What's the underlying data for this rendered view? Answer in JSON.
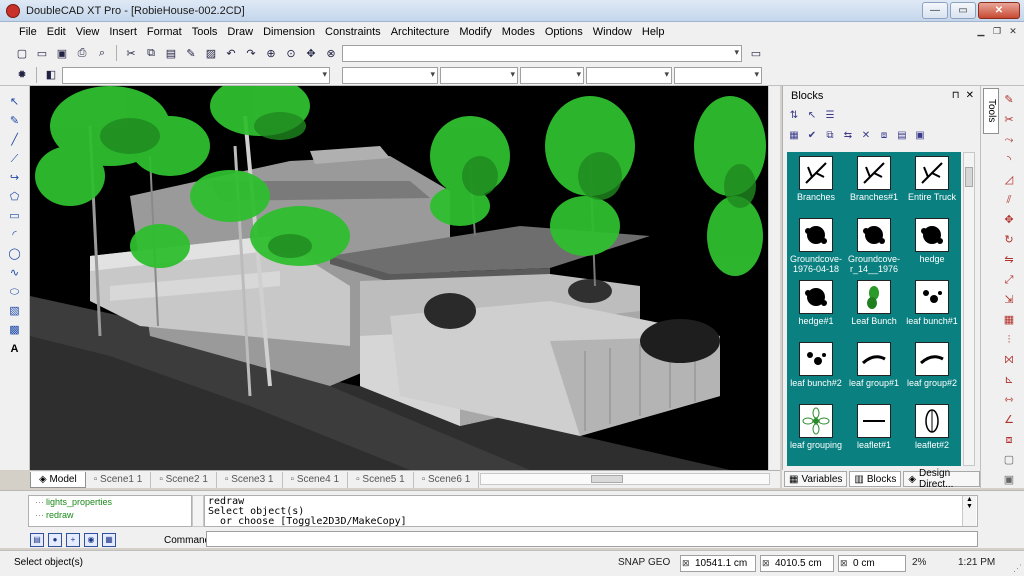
{
  "window": {
    "title": "DoubleCAD XT Pro - [RobieHouse-002.2CD]",
    "buttons": [
      "—",
      "▭",
      "✕"
    ]
  },
  "menu": [
    "File",
    "Edit",
    "View",
    "Insert",
    "Format",
    "Tools",
    "Draw",
    "Dimension",
    "Constraints",
    "Architecture",
    "Modify",
    "Modes",
    "Options",
    "Window",
    "Help"
  ],
  "left_tools": [
    "select-arrow",
    "pencil",
    "line",
    "polyline",
    "curve",
    "polygon",
    "rectangle",
    "arc",
    "circle",
    "spline",
    "ellipse",
    "hatch",
    "layer",
    "text"
  ],
  "scene_tabs": [
    "Model",
    "Scene1 1",
    "Scene2 1",
    "Scene3 1",
    "Scene4 1",
    "Scene5 1",
    "Scene6 1"
  ],
  "panel": {
    "title": "Blocks",
    "controls": [
      "⊓",
      "✕"
    ],
    "blocks": [
      {
        "label": "Branches",
        "icon": "branch"
      },
      {
        "label": "Branches#1",
        "icon": "branch"
      },
      {
        "label": "Entire Truck",
        "icon": "branch"
      },
      {
        "label": "Groundcove-\n1976-04-18",
        "icon": "blob"
      },
      {
        "label": "Groundcove-\nr_14__1976",
        "icon": "blob"
      },
      {
        "label": "hedge",
        "icon": "blob"
      },
      {
        "label": "hedge#1",
        "icon": "blob"
      },
      {
        "label": "Leaf Bunch",
        "icon": "leaf-green"
      },
      {
        "label": "leaf bunch#1",
        "icon": "dots"
      },
      {
        "label": "leaf bunch#2",
        "icon": "dots"
      },
      {
        "label": "leaf group#1",
        "icon": "stroke"
      },
      {
        "label": "leaf group#2",
        "icon": "stroke"
      },
      {
        "label": "leaf grouping",
        "icon": "flower"
      },
      {
        "label": "leaflet#1",
        "icon": "line"
      },
      {
        "label": "leaflet#2",
        "icon": "lens"
      }
    ],
    "tabs": [
      "Variables",
      "Blocks",
      "Design Direct..."
    ],
    "vertical_tab": "Tools"
  },
  "command": {
    "tree": [
      "lights_properties",
      "redraw"
    ],
    "history": [
      "redraw",
      "Select object(s)",
      "  or choose [Toggle2D3D/MakeCopy]"
    ],
    "label": "Command:",
    "input": ""
  },
  "status": {
    "message": "Select object(s)",
    "snap": "SNAP",
    "geo": "GEO",
    "x": "10541.1 cm",
    "y": "4010.5 cm",
    "z": "0 cm",
    "zoom": "2%",
    "time": "1:21 PM"
  },
  "colors": {
    "blocks_bg": "#0a8080",
    "viewport_bg": "#000000",
    "foliage": "#2fbf2f"
  }
}
